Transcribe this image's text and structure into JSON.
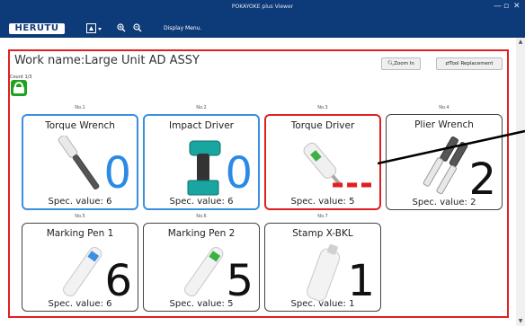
{
  "window": {
    "title": "POKAYOKE plus Viewer",
    "controls": [
      "—",
      "▫",
      "✕"
    ]
  },
  "menubar": {
    "logo": "HERUTU",
    "display_menu": "Display Menu."
  },
  "work": {
    "title": "Work name:Large Unit AD ASSY",
    "count_label": "Count 1/3"
  },
  "buttons": {
    "zoom_in": "Zoom In",
    "tool_replacement": "Tool Replacement"
  },
  "tools": [
    {
      "no": "No.1",
      "name": "Torque Wrench",
      "count": "0",
      "spec": "Spec. value: 6",
      "state": "active"
    },
    {
      "no": "No.2",
      "name": "Impact Driver",
      "count": "0",
      "spec": "Spec. value: 6",
      "state": "active"
    },
    {
      "no": "No.3",
      "name": "Torque Driver",
      "count": "---",
      "spec": "Spec. value: 5",
      "state": "error"
    },
    {
      "no": "No.4",
      "name": "Plier Wrench",
      "count": "2",
      "spec": "Spec. value: 2",
      "state": "normal"
    },
    {
      "no": "No.5",
      "name": "Marking Pen 1",
      "count": "6",
      "spec": "Spec. value: 6",
      "state": "normal"
    },
    {
      "no": "No.6",
      "name": "Marking Pen 2",
      "count": "5",
      "spec": "Spec. value: 5",
      "state": "normal"
    },
    {
      "no": "No.7",
      "name": "Stamp X-BKL",
      "count": "1",
      "spec": "Spec. value: 1",
      "state": "normal"
    }
  ],
  "colors": {
    "titlebar": "#0d3a78",
    "active_border": "#3b8fe0",
    "error_border": "#e02020",
    "count_ok": "#1fa31f"
  }
}
